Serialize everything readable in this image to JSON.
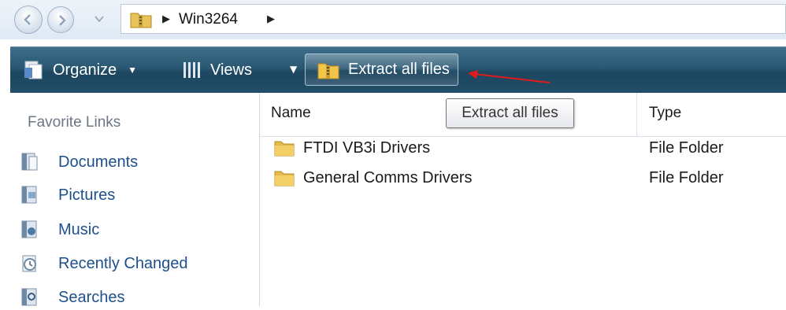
{
  "address": {
    "breadcrumb": "Win3264"
  },
  "toolbar": {
    "organize_label": "Organize",
    "views_label": "Views",
    "extract_label": "Extract all files"
  },
  "tooltip": {
    "text": "Extract all files"
  },
  "nav": {
    "heading": "Favorite Links",
    "items": [
      {
        "label": "Documents",
        "icon": "documents-icon"
      },
      {
        "label": "Pictures",
        "icon": "pictures-icon"
      },
      {
        "label": "Music",
        "icon": "music-icon"
      },
      {
        "label": "Recently Changed",
        "icon": "recently-changed-icon"
      },
      {
        "label": "Searches",
        "icon": "searches-icon"
      }
    ]
  },
  "columns": {
    "name": "Name",
    "type": "Type"
  },
  "files": [
    {
      "name": "FTDI VB3i Drivers",
      "type": "File Folder",
      "icon": "folder-icon"
    },
    {
      "name": "General Comms Drivers",
      "type": "File Folder",
      "icon": "folder-icon"
    }
  ],
  "colors": {
    "command_bar": "#2a5873",
    "link_text": "#1e4f8c",
    "annotation_arrow": "#e01b1b"
  }
}
